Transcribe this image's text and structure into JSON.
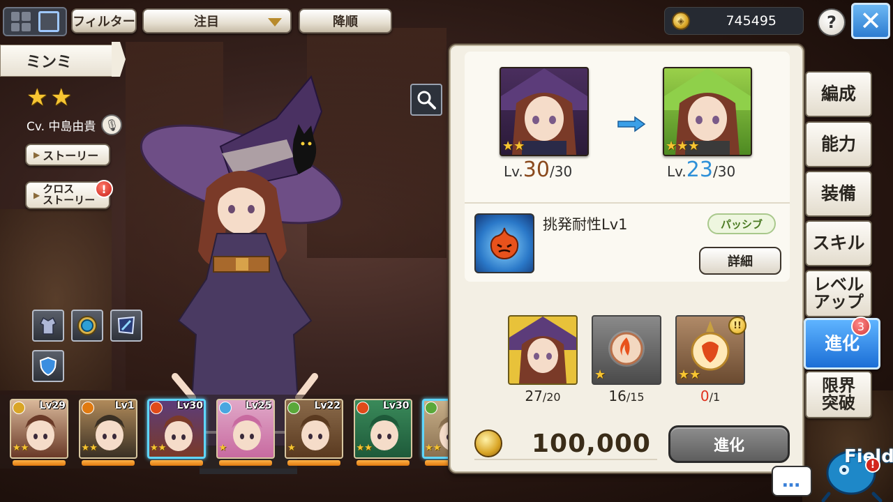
{
  "top_bar": {
    "filter_label": "フィルター",
    "sort_field": "注目",
    "sort_order": "降順",
    "gold": "745495",
    "help_label": "?",
    "close_label": "✕"
  },
  "character": {
    "name": "ミンミ",
    "rarity_stars": 2,
    "voice": "Cv. 中島由貴",
    "story_label": "ストーリー",
    "cross_story_label": "クロス\nストーリー",
    "cross_story_alert": "!"
  },
  "roster": [
    {
      "level": "Lv29",
      "stars": "★★",
      "selected": false,
      "element": "#d9a526"
    },
    {
      "level": "Lv1",
      "stars": "★★",
      "selected": false,
      "element": "#e07a10"
    },
    {
      "level": "Lv30",
      "stars": "★★",
      "selected": true,
      "element": "#e04a1a"
    },
    {
      "level": "Lv25",
      "stars": "★",
      "selected": false,
      "element": "#4aa6e0"
    },
    {
      "level": "Lv22",
      "stars": "★",
      "selected": false,
      "element": "#5aa83a"
    },
    {
      "level": "Lv30",
      "stars": "★★",
      "selected": false,
      "element": "#e04a1a"
    },
    {
      "level": "",
      "stars": "★★",
      "selected": true,
      "element": "#5aa83a"
    }
  ],
  "evolution": {
    "before": {
      "stars": "★★",
      "level_prefix": "Lv.",
      "level": "30",
      "max": "/30"
    },
    "after": {
      "stars": "★★★",
      "level_prefix": "Lv.",
      "level": "23",
      "max": "/30"
    },
    "skill": {
      "name": "挑発耐性Lv1",
      "type": "パッシブ",
      "detail_label": "詳細"
    },
    "materials": [
      {
        "have": "27",
        "need": "/20",
        "stars": "",
        "lacking": false
      },
      {
        "have": "16",
        "need": "/15",
        "stars": "★",
        "lacking": false
      },
      {
        "have": "0",
        "need": "/1",
        "stars": "★★",
        "lacking": true,
        "alert": "!!"
      }
    ],
    "cost": "100,000",
    "evolve_label": "進化"
  },
  "tabs": [
    {
      "label": "編成"
    },
    {
      "label": "能力"
    },
    {
      "label": "装備"
    },
    {
      "label": "スキル"
    },
    {
      "label": "レベル\nアップ"
    },
    {
      "label": "進化",
      "badge": "3"
    },
    {
      "label": "限界\n突破"
    }
  ],
  "field": {
    "label": "Field",
    "badge": "!"
  },
  "chat_label": "…"
}
